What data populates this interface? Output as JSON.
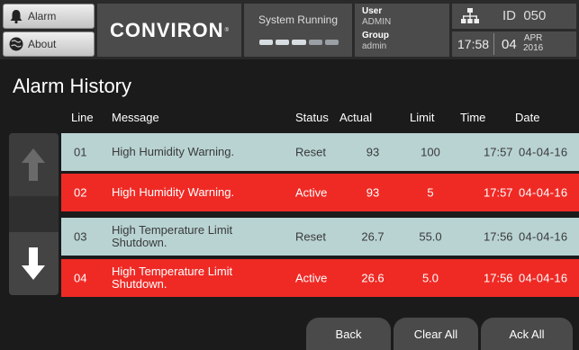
{
  "header": {
    "nav": [
      {
        "label": "Alarm",
        "icon": "bell-icon"
      },
      {
        "label": "About",
        "icon": "globe-icon"
      }
    ],
    "brand": "CONVIRON",
    "brand_mark": "®",
    "system_status": "System Running",
    "user_label": "User",
    "user_value": "ADMIN",
    "group_label": "Group",
    "group_value": "admin",
    "network_icon": "network-icon",
    "id_text": "ID  050",
    "time": "17:58",
    "day": "04",
    "month": "APR",
    "year": "2016"
  },
  "page": {
    "title": "Alarm History"
  },
  "table": {
    "columns": {
      "line": "Line",
      "message": "Message",
      "status": "Status",
      "actual": "Actual",
      "limit": "Limit",
      "time": "Time",
      "date": "Date"
    },
    "rows": [
      {
        "line": "01",
        "message": "High Humidity Warning.",
        "status": "Reset",
        "actual": "93",
        "limit": "100",
        "time": "17:57",
        "date": "04-04-16"
      },
      {
        "line": "02",
        "message": "High Humidity Warning.",
        "status": "Active",
        "actual": "93",
        "limit": "5",
        "time": "17:57",
        "date": "04-04-16"
      },
      {
        "line": "03",
        "message": "High Temperature Limit Shutdown.",
        "status": "Reset",
        "actual": "26.7",
        "limit": "55.0",
        "time": "17:56",
        "date": "04-04-16"
      },
      {
        "line": "04",
        "message": "High Temperature Limit Shutdown.",
        "status": "Active",
        "actual": "26.6",
        "limit": "5.0",
        "time": "17:56",
        "date": "04-04-16"
      }
    ]
  },
  "footer": {
    "back": "Back",
    "clear_all": "Clear All",
    "ack_all": "Ack All"
  },
  "colors": {
    "reset_row": "#b9d3d3",
    "active_row": "#ef2a25",
    "panel": "#4b4b4b",
    "background": "#1b1b1b"
  }
}
